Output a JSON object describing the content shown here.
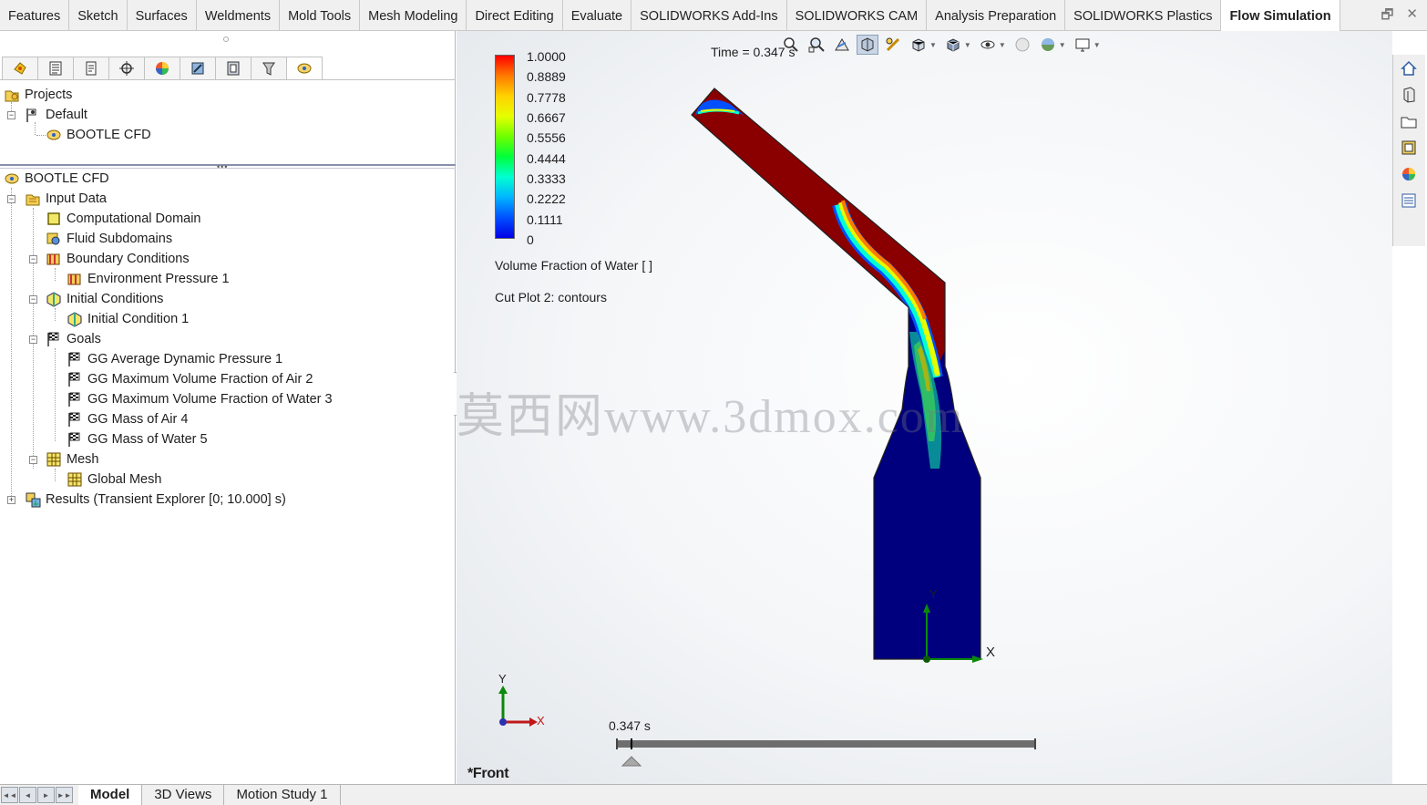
{
  "command_tabs": [
    {
      "label": "Features"
    },
    {
      "label": "Sketch"
    },
    {
      "label": "Surfaces"
    },
    {
      "label": "Weldments"
    },
    {
      "label": "Mold Tools"
    },
    {
      "label": "Mesh Modeling"
    },
    {
      "label": "Direct Editing"
    },
    {
      "label": "Evaluate"
    },
    {
      "label": "SOLIDWORKS Add-Ins"
    },
    {
      "label": "SOLIDWORKS CAM"
    },
    {
      "label": "Analysis Preparation"
    },
    {
      "label": "SOLIDWORKS Plastics"
    },
    {
      "label": "Flow Simulation",
      "active": true
    }
  ],
  "window_controls": {
    "restore": "restore-icon",
    "close": "close-icon",
    "restore_glyph": "🗗",
    "close_glyph": "✕"
  },
  "panel_tabs": [
    "flow-analysis-icon",
    "feature-tree-icon",
    "property-manager-icon",
    "configuration-icon",
    "appearance-icon",
    "cam-icon",
    "dimxpert-icon",
    "display-icon",
    "flow-simulation-icon"
  ],
  "project_tree": {
    "root": "Projects",
    "default": "Default",
    "project": "BOOTLE CFD"
  },
  "analysis_tree": {
    "root": "BOOTLE CFD",
    "input_data": "Input Data",
    "computational_domain": "Computational Domain",
    "fluid_subdomains": "Fluid Subdomains",
    "boundary_conditions": "Boundary Conditions",
    "environment_pressure": "Environment Pressure 1",
    "initial_conditions": "Initial Conditions",
    "initial_condition_1": "Initial Condition 1",
    "goals": "Goals",
    "goal_1": "GG Average Dynamic Pressure 1",
    "goal_2": "GG Maximum Volume Fraction of Air 2",
    "goal_3": "GG Maximum Volume Fraction of Water 3",
    "goal_4": "GG Mass of Air 4",
    "goal_5": "GG Mass of Water 5",
    "mesh": "Mesh",
    "global_mesh": "Global Mesh",
    "results": "Results (Transient Explorer [0; 10.000] s)",
    "expander_minus": "−",
    "expander_plus": "+"
  },
  "viewport": {
    "time_label": "Time = 0.347 s",
    "legend_title": "Volume Fraction of Water [ ]",
    "cut_plot": "Cut Plot 2: contours",
    "legend_ticks": [
      "1.0000",
      "0.8889",
      "0.7778",
      "0.6667",
      "0.5556",
      "0.4444",
      "0.3333",
      "0.2222",
      "0.1111",
      "0"
    ],
    "legend_colors": [
      "#ff0000",
      "#ff7a00",
      "#ffd200",
      "#e6ff00",
      "#6eff00",
      "#00ff3c",
      "#00ffd2",
      "#00b4ff",
      "#0050ff",
      "#0000e6"
    ],
    "watermark": "莫西网www.3dmox.com",
    "timeline_label": "0.347 s",
    "timeline_fraction": 0.0347,
    "view_name": "*Front",
    "triad_x": "X",
    "triad_y": "Y"
  },
  "view_toolbar": [
    "zoom-to-fit-icon",
    "zoom-to-area-icon",
    "previous-view-icon",
    "section-view-icon",
    "dynamic-annotation-icon",
    "view-orientation-icon",
    "display-style-icon",
    "hide-show-icon",
    "edit-appearance-icon",
    "apply-scene-icon",
    "view-settings-icon"
  ],
  "task_pane": [
    "home-icon",
    "resources-icon",
    "file-explorer-icon",
    "view-palette-icon",
    "appearances-icon",
    "custom-properties-icon"
  ],
  "bottom_tabs": [
    {
      "label": "Model",
      "active": true
    },
    {
      "label": "3D Views"
    },
    {
      "label": "Motion Study 1"
    }
  ],
  "bottom_nav": [
    "◄◄",
    "◄",
    "►",
    "►►"
  ]
}
